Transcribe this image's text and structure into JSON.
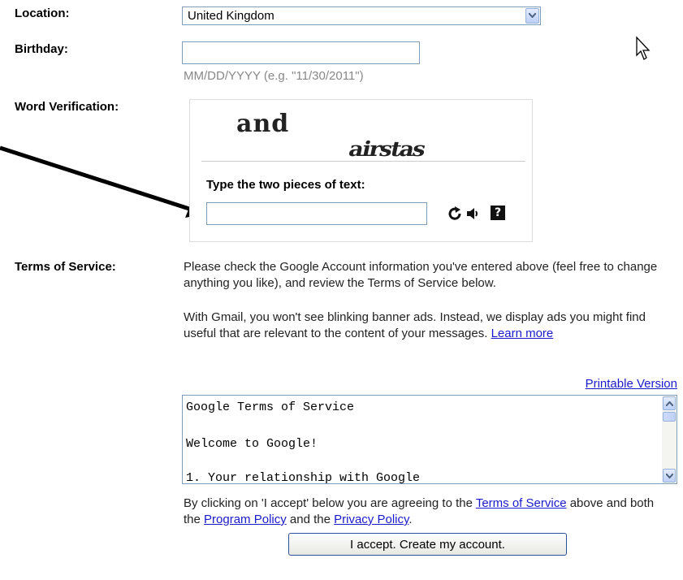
{
  "form": {
    "location_label": "Location:",
    "location_value": "United Kingdom",
    "birthday_label": "Birthday:",
    "birthday_value": "",
    "birthday_hint": "MM/DD/YYYY (e.g. \"11/30/2011\")",
    "verification_label": "Word Verification:"
  },
  "captcha": {
    "word1": "and",
    "word2": "airstas",
    "prompt": "Type the two pieces of text:",
    "input_value": "",
    "icons": [
      "refresh-icon",
      "audio-icon",
      "help-icon"
    ],
    "help_glyph": "?"
  },
  "terms": {
    "label": "Terms of Service:",
    "para1": "Please check the Google Account information you've entered above (feel free to change anything you like), and review the Terms of Service below.",
    "para2": "With Gmail, you won't see blinking banner ads. Instead, we display ads you might find useful that are relevant to the content of your messages.",
    "learn_more": "Learn more",
    "printable": "Printable Version",
    "box_lines": [
      "Google Terms of Service",
      "Welcome to Google!",
      "1. Your relationship with Google"
    ],
    "agree_pre": "By clicking on 'I accept' below you are agreeing to the",
    "tos_link": "Terms of Service",
    "agree_mid": "above and both the",
    "program_policy": "Program Policy",
    "and_the": "and the",
    "privacy_policy": "Privacy Policy",
    "end": "."
  },
  "accept_button": "I accept. Create my account."
}
